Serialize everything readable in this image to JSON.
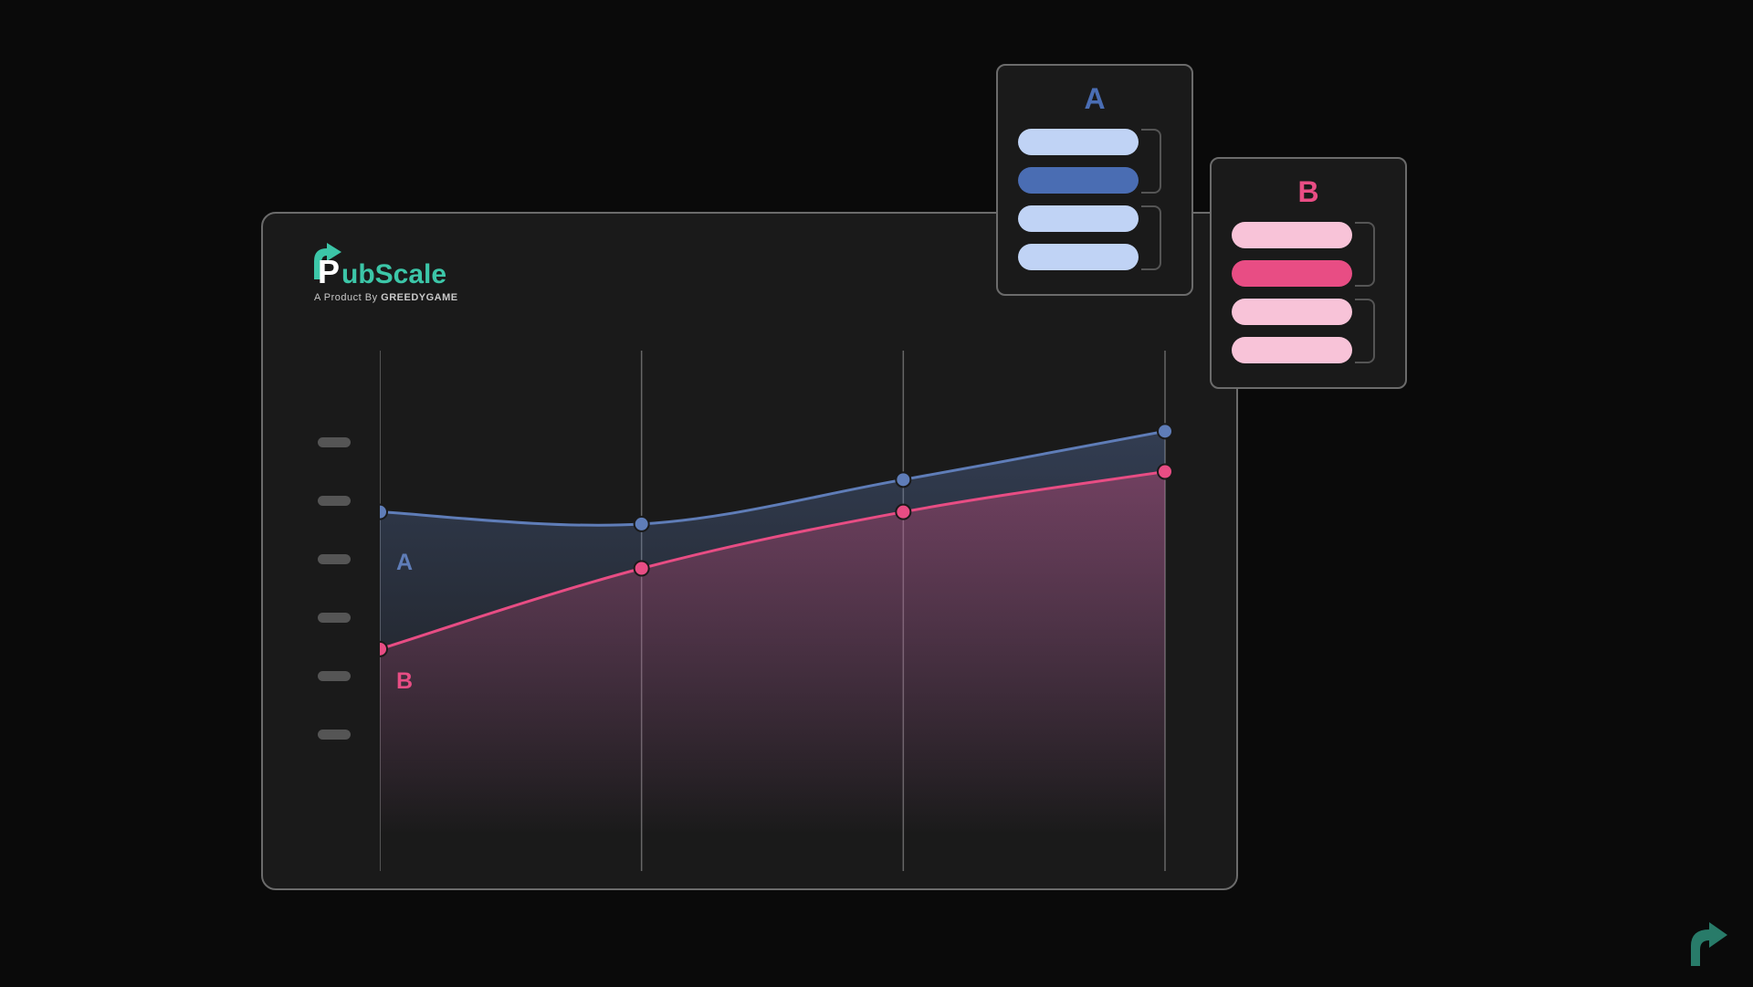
{
  "logo": {
    "name": "PubScale",
    "subtitle_prefix": "A Product By ",
    "subtitle_brand": "GREEDYGAME"
  },
  "chart_data": {
    "type": "area",
    "x": [
      0,
      1,
      2,
      3
    ],
    "series": [
      {
        "name": "A",
        "values": [
          4.0,
          3.85,
          4.4,
          5.0
        ],
        "color": "#5f7db8"
      },
      {
        "name": "B",
        "values": [
          2.3,
          3.3,
          4.0,
          4.5
        ],
        "color": "#e84d84"
      }
    ],
    "ylim": [
      0,
      6
    ],
    "title": "",
    "xlabel": "",
    "ylabel": ""
  },
  "panels": {
    "a": {
      "title": "A",
      "pills": [
        {
          "color": "#c0d3f5"
        },
        {
          "color": "#4a6db3"
        },
        {
          "color": "#c0d3f5"
        },
        {
          "color": "#c0d3f5"
        }
      ]
    },
    "b": {
      "title": "B",
      "pills": [
        {
          "color": "#f8c3d8"
        },
        {
          "color": "#e84d84"
        },
        {
          "color": "#f8c3d8"
        },
        {
          "color": "#f8c3d8"
        }
      ]
    }
  },
  "y_tick_count": 6
}
